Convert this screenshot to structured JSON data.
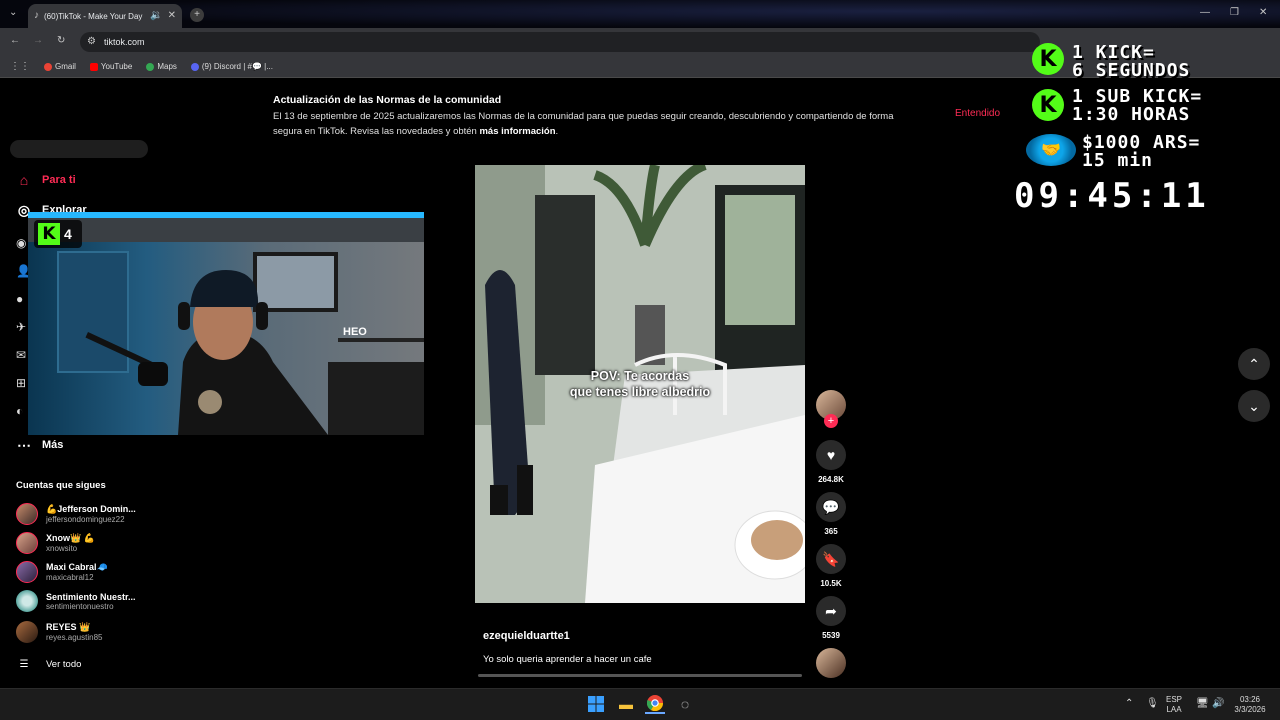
{
  "browser": {
    "tab_title": "(60)TikTok - Make Your Day",
    "url": "tiktok.com",
    "bookmarks": [
      "Gmail",
      "YouTube",
      "Maps",
      "(9) Discord | #💬 |..."
    ]
  },
  "notice": {
    "title": "Actualización de las Normas de la comunidad",
    "body": "El 13 de septiembre de 2025 actualizaremos las Normas de la comunidad para que puedas seguir creando, descubriendo y compartiendo de forma segura en TikTok. Revisa las novedades y obtén",
    "link": "más información",
    "button": "Entendido"
  },
  "sidebar": {
    "for_you": "Para ti",
    "explore": "Explorar",
    "more": "Más",
    "following_title": "Cuentas que sigues",
    "see_all": "Ver todo",
    "accounts": [
      {
        "name": "💪Jefferson Domin...",
        "handle": "jeffersondominguez22"
      },
      {
        "name": "Xnow👑 💪",
        "handle": "xnowsito"
      },
      {
        "name": "Maxi Cabral🧢",
        "handle": "maxicabral12"
      },
      {
        "name": "Sentimiento Nuestr...",
        "handle": "sentimientonuestro"
      },
      {
        "name": "REYES 👑",
        "handle": "reyes.agustin85"
      }
    ]
  },
  "webcam": {
    "kick_badge": "4",
    "neon_sign": "HEO"
  },
  "video": {
    "caption_line1": "POV: Te acordas",
    "caption_line2": "que tenes libre albedrio",
    "author": "ezequielduartte1",
    "description": "Yo solo queria aprender a hacer un cafe",
    "likes": "264.8K",
    "comments": "365",
    "saves": "10.5K",
    "shares": "5539"
  },
  "overlay": {
    "line1a": "1 KICK=",
    "line1b": "6 SEGUNDOS",
    "line2a": "1 SUB KICK=",
    "line2b": "1:30 HORAS",
    "line3a": "$1000 ARS=",
    "line3b": "15 min",
    "timer": "09:45:11"
  },
  "taskbar": {
    "lang1": "ESP",
    "lang2": "LAA",
    "time": "03:26",
    "date": "3/3/2026"
  },
  "colors": {
    "accent": "#fe2c55",
    "kick_green": "#53fc18"
  }
}
